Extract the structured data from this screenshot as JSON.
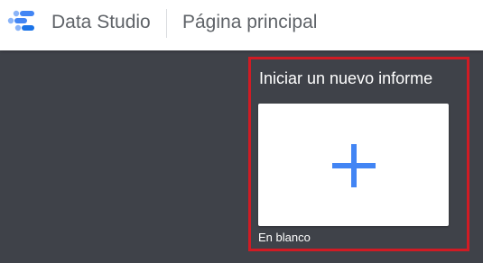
{
  "header": {
    "app_name": "Data Studio",
    "page_title": "Página principal",
    "logo_icon": "data-studio-logo-icon"
  },
  "new_report": {
    "heading": "Iniciar un nuevo informe",
    "blank_template": {
      "icon": "plus-icon",
      "caption": "En blanco"
    }
  },
  "colors": {
    "header_bg": "#ffffff",
    "page_bg": "#3f4249",
    "highlight_border": "#d01b24",
    "accent_blue": "#4285f4",
    "logo_light_blue": "#8ab4f8",
    "logo_dark_blue": "#1a73e8",
    "header_text": "#5f6368"
  }
}
